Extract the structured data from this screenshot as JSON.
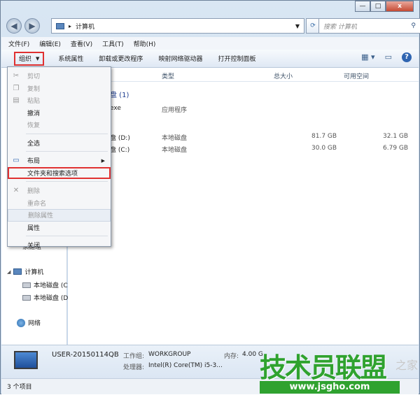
{
  "window": {
    "minimize_icon": "minimize-icon",
    "maximize_icon": "maximize-icon",
    "close_label": "x"
  },
  "nav": {
    "back_icon": "back-arrow-icon",
    "forward_icon": "forward-arrow-icon"
  },
  "address": {
    "separator": "▸",
    "location": "计算机"
  },
  "search": {
    "placeholder": "搜索 计算机"
  },
  "menubar": [
    "文件(F)",
    "编辑(E)",
    "查看(V)",
    "工具(T)",
    "帮助(H)"
  ],
  "toolbar": {
    "organize": "组织",
    "items": [
      "系统属性",
      "卸载或更改程序",
      "映射网络驱动器",
      "打开控制面板"
    ]
  },
  "columns": [
    "类型",
    "总大小",
    "可用空间"
  ],
  "content": {
    "group_partial": "盘 (1)",
    "exe_partial": "exe",
    "exe_type": "应用程序",
    "drives": [
      {
        "name": "盘 (D:)",
        "type": "本地磁盘",
        "total": "81.7 GB",
        "free": "32.1 GB"
      },
      {
        "name": "盘 (C:)",
        "type": "本地磁盘",
        "total": "30.0 GB",
        "free": "6.79 GB"
      }
    ]
  },
  "context_menu": [
    {
      "label": "剪切",
      "disabled": true,
      "icon": "scissors-icon"
    },
    {
      "label": "复制",
      "disabled": true,
      "icon": "copy-icon"
    },
    {
      "label": "粘贴",
      "disabled": true,
      "icon": "paste-icon"
    },
    {
      "label": "撤消",
      "disabled": false
    },
    {
      "label": "恢复",
      "disabled": true
    },
    {
      "sep": true
    },
    {
      "label": "全选",
      "disabled": false
    },
    {
      "sep": true
    },
    {
      "label": "布局",
      "disabled": false,
      "submenu": true,
      "icon": "layout-icon"
    },
    {
      "label": "文件夹和搜索选项",
      "disabled": false,
      "selected": true
    },
    {
      "sep": true
    },
    {
      "label": "删除",
      "disabled": true,
      "icon": "delete-icon"
    },
    {
      "label": "重命名",
      "disabled": true
    },
    {
      "label": "删除属性",
      "disabled": true,
      "highlight": true
    },
    {
      "label": "属性",
      "disabled": false
    },
    {
      "sep": true
    },
    {
      "label": "关闭",
      "disabled": false
    }
  ],
  "navpane": {
    "partial": "家庭组",
    "computer": "计算机",
    "disk1": "本地磁盘 (C",
    "disk2": "本地磁盘 (D",
    "network": "网络"
  },
  "details": {
    "name": "USER-20150114QB",
    "workgroup_label": "工作组:",
    "workgroup": "WORKGROUP",
    "memory_label": "内存:",
    "memory": "4.00 G",
    "cpu_label": "处理器:",
    "cpu": "Intel(R) Core(TM) i5-3..."
  },
  "status": "3 个项目",
  "watermark": {
    "main": "技术员联盟",
    "url": "www.jsgho.com",
    "side": "之家"
  }
}
